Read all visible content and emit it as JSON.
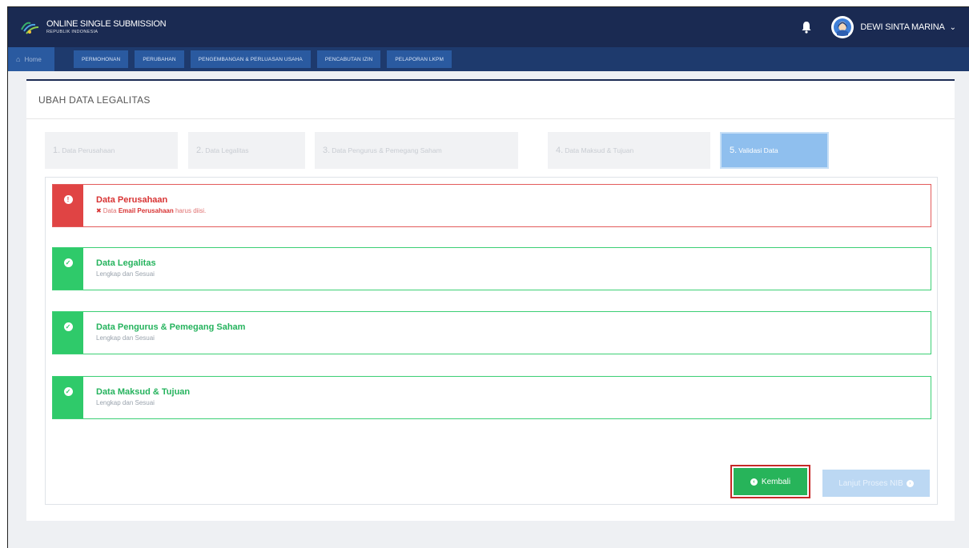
{
  "brand": {
    "title": "ONLINE SINGLE SUBMISSION",
    "subtitle": "REPUBLIK INDONESIA"
  },
  "user": {
    "name": "DEWI SINTA MARINA",
    "caret": "⌄"
  },
  "nav": {
    "home": "Home",
    "items": [
      "PERMOHONAN",
      "PERUBAHAN",
      "PENGEMBANGAN & PERLUASAN USAHA",
      "PENCABUTAN IZIN",
      "PELAPORAN LKPM"
    ]
  },
  "page": {
    "title": "UBAH DATA LEGALITAS"
  },
  "steps": [
    {
      "num": "1.",
      "label": "Data Perusahaan",
      "active": false
    },
    {
      "num": "2.",
      "label": "Data Legalitas",
      "active": false
    },
    {
      "num": "3.",
      "label": "Data Pengurus & Pemegang Saham",
      "active": false
    },
    {
      "num": "4.",
      "label": "Data Maksud & Tujuan",
      "active": false
    },
    {
      "num": "5.",
      "label": "Validasi Data",
      "active": true
    }
  ],
  "results": [
    {
      "status": "error",
      "title": "Data Perusahaan",
      "error_prefix": "Data ",
      "error_bold": "Email Perusahaan",
      "error_suffix": " harus diisi."
    },
    {
      "status": "ok",
      "title": "Data Legalitas",
      "subtitle": "Lengkap dan Sesuai"
    },
    {
      "status": "ok",
      "title": "Data Pengurus & Pemegang Saham",
      "subtitle": "Lengkap dan Sesuai"
    },
    {
      "status": "ok",
      "title": "Data Maksud & Tujuan",
      "subtitle": "Lengkap dan Sesuai"
    }
  ],
  "buttons": {
    "back": "Kembali",
    "next": "Lanjut Proses NIB"
  },
  "colors": {
    "topbar": "#1a2a52",
    "navbar": "#1e3a6d",
    "error": "#e04444",
    "success": "#2fca6a",
    "step_active": "#8fbfee"
  }
}
